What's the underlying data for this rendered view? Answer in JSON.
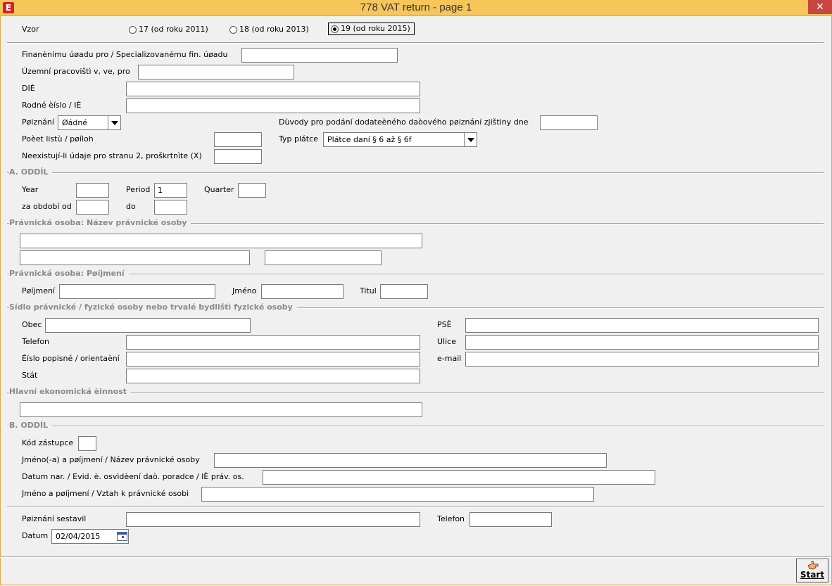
{
  "window": {
    "title": "778 VAT return - page 1",
    "app_icon": "E",
    "close": "✕"
  },
  "vzor": {
    "label": "Vzor",
    "options": [
      "17 (od roku 2011)",
      "18 (od roku 2013)",
      "19 (od roku 2015)"
    ],
    "selected": "19 (od roku 2015)"
  },
  "header": {
    "fu_label": "Finanènímu úøadu pro / Specializovanému  fin. úøadu",
    "fu_value": "",
    "uzemni_label": "Územní pracovištì v, ve, pro",
    "uzemni_value": "",
    "dic_label": "DIÈ",
    "dic_value": "",
    "rc_label": "Rodné èíslo / IÈ",
    "rc_value": "",
    "priznani_label": "Pøiznání",
    "priznani_value": "Øádné",
    "duvody_label": "Dùvody pro podání dodateèného daòového pøiznání zjištiny dne",
    "duvody_value": "",
    "pocet_label": "Poèet listù / pøíloh",
    "pocet_value": "",
    "typ_label": "Typ plátce",
    "typ_value": "Plátce daní § 6 až § 6f",
    "neex_label": "Neexistují-li údaje pro stranu 2, proškrtnìte (X)",
    "neex_value": ""
  },
  "oddil_a": {
    "title": "A. ODDÍL",
    "year_label": "Year",
    "year_value": "",
    "period_label": "Period",
    "period_value": "1",
    "quarter_label": "Quarter",
    "quarter_value": "",
    "od_label": "za období od",
    "od_value": "",
    "do_label": "do",
    "do_value": ""
  },
  "pravnicka_nazev": {
    "title": "Právnická osoba: Název právnické osoby",
    "line1": "",
    "line2": "",
    "line3": ""
  },
  "pravnicka_prijmeni": {
    "title": "Právnická osoba: Pøíjmení",
    "prijmeni_label": "Pøíjmení",
    "prijmeni_value": "",
    "jmeno_label": "Jméno",
    "jmeno_value": "",
    "titul_label": "Titul",
    "titul_value": ""
  },
  "sidlo": {
    "title": "Sídlo právnické / fyzické osoby nebo trvalé bydlištì fyzické osoby",
    "obec_label": "Obec",
    "obec_value": "",
    "psc_label": "PSÈ",
    "psc_value": "",
    "telefon_label": "Telefon",
    "telefon_value": "",
    "ulice_label": "Ulice",
    "ulice_value": "",
    "cislo_label": "Èíslo popisné / orientaèní",
    "cislo_value": "",
    "email_label": "e-mail",
    "email_value": "",
    "stat_label": "Stát",
    "stat_value": ""
  },
  "ekonomicka": {
    "title": "Hlavní ekonomická èinnost",
    "value": ""
  },
  "oddil_b": {
    "title": "B. ODDÍL",
    "kod_label": "Kód zástupce",
    "kod_value": "",
    "jmeno_label": "Jméno(-a) a pøíjmení / Název právnické osoby",
    "jmeno_value": "",
    "datum_label": "Datum nar. / Evid. è. osvìdèení daò. poradce / IÈ práv. os.",
    "datum_value": "",
    "vztah_label": "Jméno a pøíjmení / Vztah k právnické osobì",
    "vztah_value": ""
  },
  "footer": {
    "sestavil_label": "Pøiznání sestavil",
    "sestavil_value": "",
    "telefon_label": "Telefon",
    "telefon_value": "",
    "datum_label": "Datum",
    "datum_value": "02/04/2015"
  },
  "buttons": {
    "start": "Start"
  }
}
